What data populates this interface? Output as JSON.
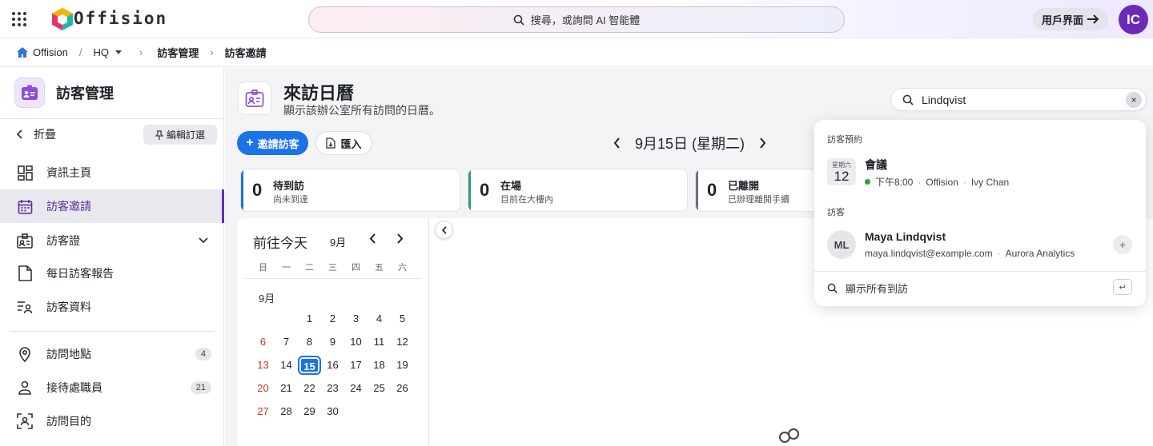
{
  "app": {
    "name": "Offision",
    "user_initials": "IC",
    "ui_button": "用戶界面",
    "accent": "#6a2bb8"
  },
  "search": {
    "placeholder": "搜尋，或詢問 AI 智能體"
  },
  "breadcrumb": {
    "home": "Offision",
    "site": "HQ",
    "section": "訪客管理",
    "page": "訪客邀請"
  },
  "sidebar": {
    "title": "訪客管理",
    "collapse_label": "折疊",
    "edit_label": "編輯訂選",
    "items": [
      {
        "label": "資訊主頁",
        "icon": "dashboard-icon"
      },
      {
        "label": "訪客邀請",
        "icon": "calendar-icon",
        "active": true
      },
      {
        "label": "訪客證",
        "icon": "badge-icon"
      },
      {
        "label": "每日訪客報告",
        "icon": "report-icon"
      },
      {
        "label": "訪客資料",
        "icon": "person-list-icon"
      },
      {
        "label": "訪問地點",
        "icon": "location-icon",
        "count": "4"
      },
      {
        "label": "接待處職員",
        "icon": "person-icon",
        "count": "21"
      },
      {
        "label": "訪問目的",
        "icon": "scan-person-icon"
      }
    ]
  },
  "page": {
    "title": "來訪日曆",
    "subtitle": "顯示該辦公室所有訪問的日曆。",
    "invite_label": "邀請訪客",
    "import_label": "匯入",
    "current_date": "9月15日 (星期二)"
  },
  "stats": [
    {
      "count": "0",
      "label": "待到訪",
      "desc": "尚未到達",
      "color": "#1a73e8"
    },
    {
      "count": "0",
      "label": "在場",
      "desc": "目前在大樓內",
      "color": "#2e9e6a"
    },
    {
      "count": "0",
      "label": "已離開",
      "desc": "已辦理離開手續",
      "color": "#6b7280"
    }
  ],
  "calendar": {
    "goto_today": "前往今天",
    "month_select": "9月",
    "weekdays": [
      "日",
      "一",
      "二",
      "三",
      "四",
      "五",
      "六"
    ],
    "month_label": "9月",
    "selected_day": "15"
  },
  "search_panel": {
    "query": "Lindqvist",
    "bookings_heading": "訪客預約",
    "booking": {
      "weekday": "星期六",
      "day": "12",
      "title": "會議",
      "time": "下午8:00",
      "location": "Offision",
      "host": "Ivy Chan"
    },
    "visitors_heading": "訪客",
    "visitor": {
      "initials": "ML",
      "name": "Maya Lindqvist",
      "email": "maya.lindqvist@example.com",
      "company": "Aurora Analytics"
    },
    "show_all": "顯示所有到訪"
  }
}
